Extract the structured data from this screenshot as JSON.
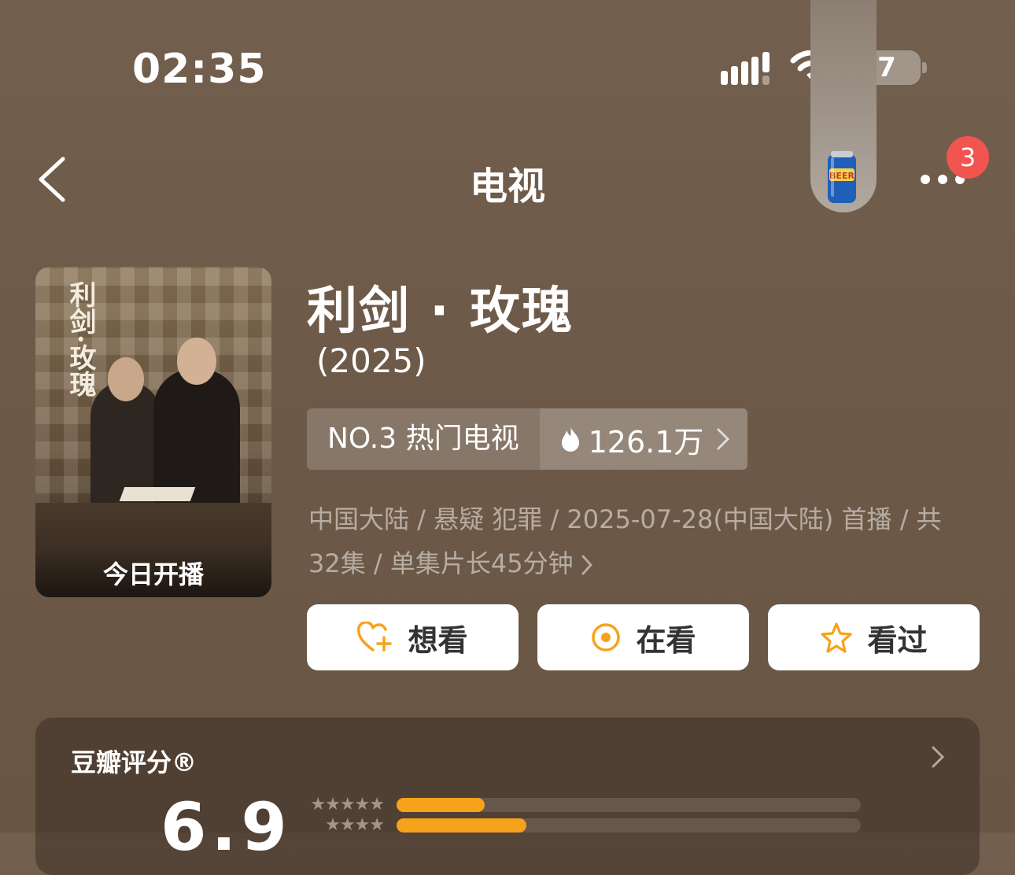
{
  "status_bar": {
    "time": "02:35",
    "battery": "7"
  },
  "nav": {
    "title": "电视",
    "badge": "3"
  },
  "poster": {
    "label": "今日开播",
    "calligraphy": "利剑·玫瑰"
  },
  "show": {
    "title": "利剑 · 玫瑰",
    "year": "(2025)",
    "rank_label": "NO.3 热门电视",
    "heat": "126.1万",
    "meta_line1": "中国大陆 / 悬疑 犯罪 / 2025-07-28(中国大陆) 首播 / 共",
    "meta_line2": "32集 / 单集片长45分钟"
  },
  "actions": {
    "want": "想看",
    "watching": "在看",
    "watched": "看过"
  },
  "rating": {
    "title": "豆瓣评分®",
    "score": "6.9",
    "bars": [
      {
        "stars": "★★★★★",
        "fraction": 0.19
      },
      {
        "stars": "★★★★",
        "fraction": 0.28
      }
    ]
  },
  "colors": {
    "accent": "#f7a21b",
    "badge": "#f2544f",
    "background": "#6e5a48"
  },
  "icons": [
    "back-icon",
    "more-icon",
    "beer-can-icon",
    "flame-icon",
    "heart-plus-icon",
    "target-icon",
    "star-icon",
    "chevron-right-icon"
  ]
}
